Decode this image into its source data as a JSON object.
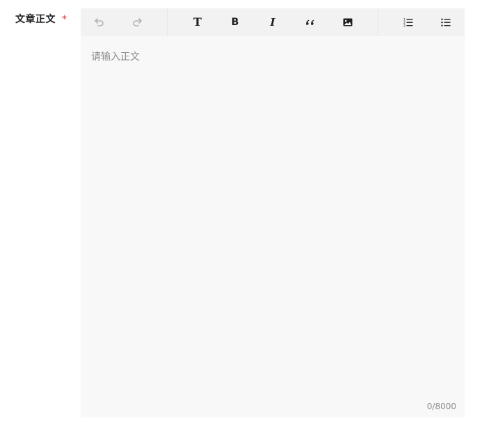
{
  "form": {
    "label": "文章正文",
    "required_mark": "*"
  },
  "editor": {
    "placeholder": "请输入正文",
    "char_count": "0/8000",
    "toolbar": [
      {
        "icon": "undo-icon",
        "enabled": false
      },
      {
        "icon": "redo-icon",
        "enabled": false
      },
      {
        "icon": "heading-icon",
        "glyph": "T"
      },
      {
        "icon": "bold-icon",
        "glyph": "B"
      },
      {
        "icon": "italic-icon",
        "glyph": "I"
      },
      {
        "icon": "quote-icon"
      },
      {
        "icon": "image-icon"
      },
      {
        "icon": "ordered-list-icon"
      },
      {
        "icon": "bullet-list-icon"
      }
    ]
  },
  "colors": {
    "required": "#e5322d",
    "toolbar_bg": "#f2f2f3",
    "editor_bg": "#f8f8f8",
    "icon": "#1f1f1f",
    "icon_disabled": "#b3b3b3",
    "placeholder": "#8c8c8c"
  }
}
